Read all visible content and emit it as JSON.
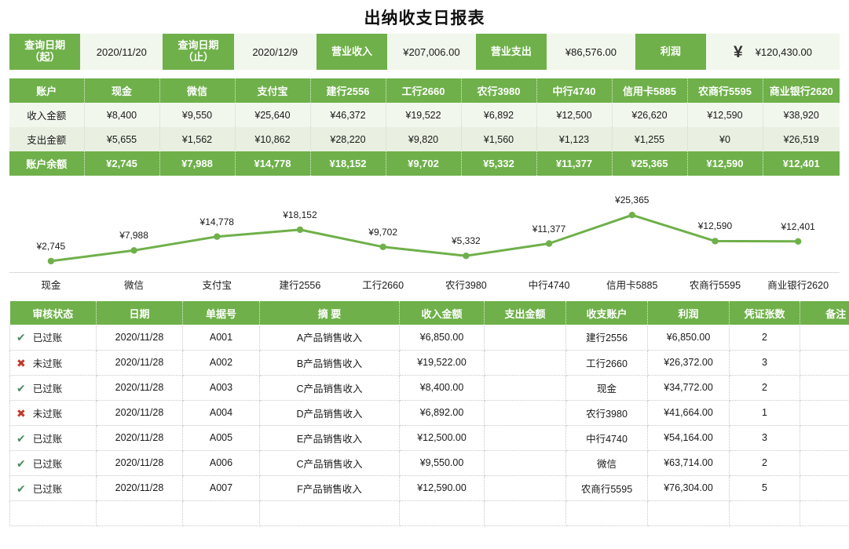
{
  "title": "出纳收支日报表",
  "summary": {
    "date_from_label": [
      "查询日期",
      "（起）"
    ],
    "date_from_value": "2020/11/20",
    "date_to_label": [
      "查询日期",
      "（止）"
    ],
    "date_to_value": "2020/12/9",
    "income_label": "营业收入",
    "income_value": "¥207,006.00",
    "expense_label": "营业支出",
    "expense_value": "¥86,576.00",
    "profit_label": "利润",
    "profit_icon": "yen-sign-icon",
    "profit_value": "¥120,430.00"
  },
  "accounts": {
    "row_labels": {
      "header": "账户",
      "income": "收入金额",
      "expense": "支出金额",
      "balance": "账户余额"
    },
    "columns": [
      "现金",
      "微信",
      "支付宝",
      "建行2556",
      "工行2660",
      "农行3980",
      "中行4740",
      "信用卡5885",
      "农商行5595",
      "商业银行2620"
    ],
    "income": [
      "¥8,400",
      "¥9,550",
      "¥25,640",
      "¥46,372",
      "¥19,522",
      "¥6,892",
      "¥12,500",
      "¥26,620",
      "¥12,590",
      "¥38,920"
    ],
    "expense": [
      "¥5,655",
      "¥1,562",
      "¥10,862",
      "¥28,220",
      "¥9,820",
      "¥1,560",
      "¥1,123",
      "¥1,255",
      "¥0",
      "¥26,519"
    ],
    "balance": [
      "¥2,745",
      "¥7,988",
      "¥14,778",
      "¥18,152",
      "¥9,702",
      "¥5,332",
      "¥11,377",
      "¥25,365",
      "¥12,590",
      "¥12,401"
    ]
  },
  "chart_data": {
    "type": "line",
    "title": "",
    "xlabel": "",
    "ylabel": "",
    "categories": [
      "现金",
      "微信",
      "支付宝",
      "建行2556",
      "工行2660",
      "农行3980",
      "中行4740",
      "信用卡5885",
      "农商行5595",
      "商业银行2620"
    ],
    "values": [
      2745,
      7988,
      14778,
      18152,
      9702,
      5332,
      11377,
      25365,
      12590,
      12401
    ],
    "labels": [
      "¥2,745",
      "¥7,988",
      "¥14,778",
      "¥18,152",
      "¥9,702",
      "¥5,332",
      "¥11,377",
      "¥25,365",
      "¥12,590",
      "¥12,401"
    ],
    "ylim": [
      0,
      27000
    ],
    "grid": false,
    "legend": false,
    "series_color": "#6FB04A",
    "marker": "circle"
  },
  "detail": {
    "headers": [
      "审核状态",
      "日期",
      "单据号",
      "摘      要",
      "收入金额",
      "支出金额",
      "收支账户",
      "利润",
      "凭证张数",
      "备注"
    ],
    "rows": [
      {
        "status": "已过账",
        "status_icon": "check-icon",
        "date": "2020/11/28",
        "voucher": "A001",
        "abstract": "A产品销售收入",
        "income": "¥6,850.00",
        "expense": "",
        "account": "建行2556",
        "profit": "¥6,850.00",
        "count": "2",
        "remark": ""
      },
      {
        "status": "未过账",
        "status_icon": "cross-icon",
        "date": "2020/11/28",
        "voucher": "A002",
        "abstract": "B产品销售收入",
        "income": "¥19,522.00",
        "expense": "",
        "account": "工行2660",
        "profit": "¥26,372.00",
        "count": "3",
        "remark": ""
      },
      {
        "status": "已过账",
        "status_icon": "check-icon",
        "date": "2020/11/28",
        "voucher": "A003",
        "abstract": "C产品销售收入",
        "income": "¥8,400.00",
        "expense": "",
        "account": "现金",
        "profit": "¥34,772.00",
        "count": "2",
        "remark": ""
      },
      {
        "status": "未过账",
        "status_icon": "cross-icon",
        "date": "2020/11/28",
        "voucher": "A004",
        "abstract": "D产品销售收入",
        "income": "¥6,892.00",
        "expense": "",
        "account": "农行3980",
        "profit": "¥41,664.00",
        "count": "1",
        "remark": ""
      },
      {
        "status": "已过账",
        "status_icon": "check-icon",
        "date": "2020/11/28",
        "voucher": "A005",
        "abstract": "E产品销售收入",
        "income": "¥12,500.00",
        "expense": "",
        "account": "中行4740",
        "profit": "¥54,164.00",
        "count": "3",
        "remark": ""
      },
      {
        "status": "已过账",
        "status_icon": "check-icon",
        "date": "2020/11/28",
        "voucher": "A006",
        "abstract": "C产品销售收入",
        "income": "¥9,550.00",
        "expense": "",
        "account": "微信",
        "profit": "¥63,714.00",
        "count": "2",
        "remark": ""
      },
      {
        "status": "已过账",
        "status_icon": "check-icon",
        "date": "2020/11/28",
        "voucher": "A007",
        "abstract": "F产品销售收入",
        "income": "¥12,590.00",
        "expense": "",
        "account": "农商行5595",
        "profit": "¥76,304.00",
        "count": "5",
        "remark": ""
      },
      {
        "status": "",
        "status_icon": "",
        "date": "",
        "voucher": "",
        "abstract": "",
        "income": "",
        "expense": "",
        "account": "",
        "profit": "",
        "count": "",
        "remark": ""
      }
    ]
  },
  "colors": {
    "accent_green": "#6FB04A",
    "light_green_a": "#F2F7EE",
    "light_green_b": "#E9F0E1",
    "summary_value_bg": "#F1F7EC",
    "check_color": "#4E8B62",
    "cross_color": "#C0392B"
  }
}
